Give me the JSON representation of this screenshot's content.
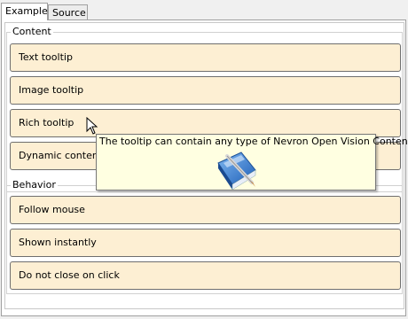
{
  "tabs": [
    {
      "label": "Example",
      "active": true
    },
    {
      "label": "Source",
      "active": false
    }
  ],
  "content_group": {
    "title": "Content",
    "buttons": [
      "Text tooltip",
      "Image tooltip",
      "Rich tooltip",
      "Dynamic content"
    ]
  },
  "behavior_group": {
    "title": "Behavior",
    "buttons": [
      "Follow mouse",
      "Shown instantly",
      "Do not close on click"
    ]
  },
  "tooltip": {
    "text": "The tooltip can contain any type of Nevron Open Vision Content",
    "icon": "book-pen-icon"
  },
  "colors": {
    "button_fill": "#fdefd3",
    "button_border": "#6e6e6e",
    "tooltip_fill": "#ffffe1",
    "icon_blue": "#2a77d6"
  }
}
